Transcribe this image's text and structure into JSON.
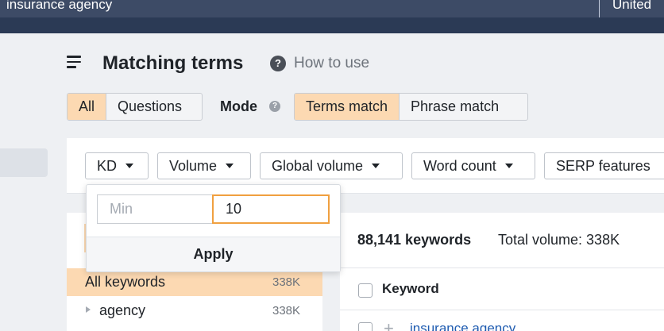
{
  "topbar": {
    "query": "insurance agency",
    "country": "United"
  },
  "header": {
    "title": "Matching terms",
    "help_link": "How to use"
  },
  "tabs": {
    "all": "All",
    "questions": "Questions"
  },
  "mode": {
    "label": "Mode",
    "terms_match": "Terms match",
    "phrase_match": "Phrase match"
  },
  "filters": {
    "kd": "KD",
    "volume": "Volume",
    "global_volume": "Global volume",
    "word_count": "Word count",
    "serp_features": "SERP features"
  },
  "popover": {
    "min_placeholder": "Min",
    "max_value": "10",
    "apply": "Apply"
  },
  "sidebar": {
    "all_keywords": {
      "label": "All keywords",
      "count": "338K"
    },
    "groups": [
      {
        "label": "agency",
        "count": "338K"
      }
    ]
  },
  "results": {
    "keyword_count": "88,141 keywords",
    "total_volume": "Total volume: 338K",
    "column_keyword": "Keyword",
    "rows": [
      {
        "keyword": "insurance agency"
      }
    ]
  },
  "colors": {
    "accent_orange": "#fcd9b2",
    "focus_orange": "#f0a040",
    "topbar": "#3d4b66",
    "link_blue": "#1e5bb0"
  }
}
